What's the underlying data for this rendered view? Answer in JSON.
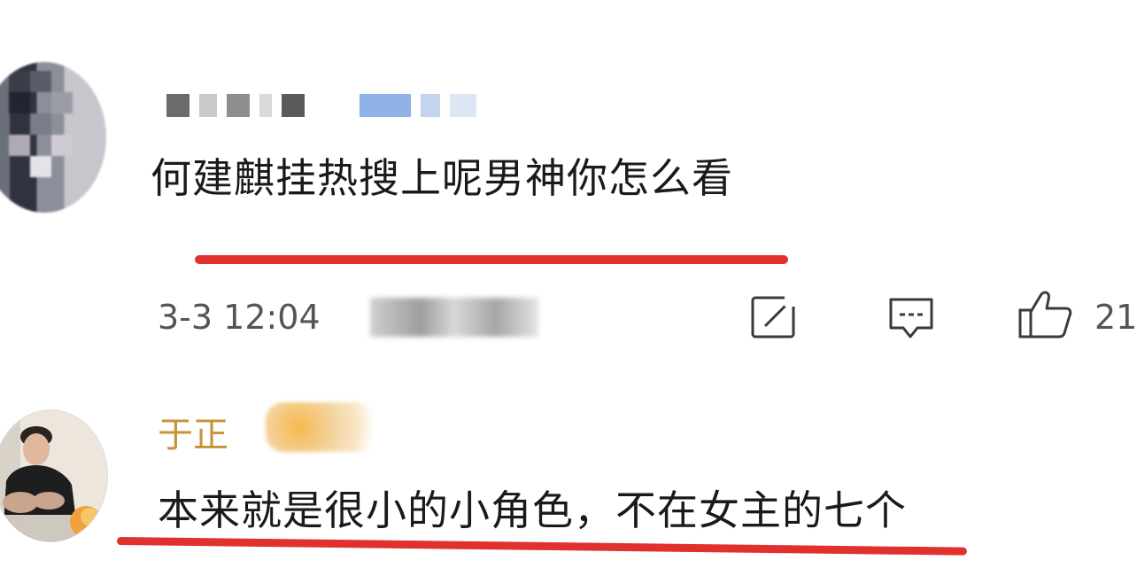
{
  "comments": [
    {
      "text": "何建麒挂热搜上呢男神你怎么看",
      "timestamp": "3-3 12:04",
      "like_count": "21",
      "icons": [
        "share-icon",
        "comment-icon",
        "like-icon"
      ]
    },
    {
      "username": "于正",
      "text": "本来就是很小的小角色，不在女主的七个"
    }
  ],
  "colors": {
    "accent_underline": "#e0312f",
    "username_color": "#c8923a",
    "text_color": "#1a1a1a",
    "meta_color": "#555555"
  }
}
